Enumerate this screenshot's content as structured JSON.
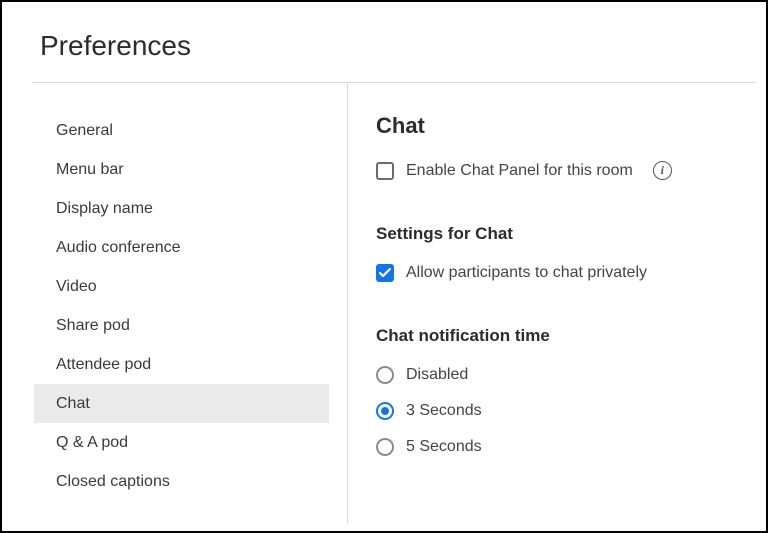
{
  "title": "Preferences",
  "sidebar": {
    "items": [
      {
        "label": "General",
        "selected": false
      },
      {
        "label": "Menu bar",
        "selected": false
      },
      {
        "label": "Display name",
        "selected": false
      },
      {
        "label": "Audio conference",
        "selected": false
      },
      {
        "label": "Video",
        "selected": false
      },
      {
        "label": "Share pod",
        "selected": false
      },
      {
        "label": "Attendee pod",
        "selected": false
      },
      {
        "label": "Chat",
        "selected": true
      },
      {
        "label": "Q & A pod",
        "selected": false
      },
      {
        "label": "Closed captions",
        "selected": false
      }
    ]
  },
  "panel": {
    "title": "Chat",
    "enable_checkbox": {
      "label": "Enable Chat Panel for this room",
      "checked": false
    },
    "settings_title": "Settings for Chat",
    "allow_private": {
      "label": "Allow participants to chat privately",
      "checked": true
    },
    "notification_title": "Chat notification time",
    "notification_options": [
      {
        "label": "Disabled",
        "selected": false
      },
      {
        "label": "3 Seconds",
        "selected": true
      },
      {
        "label": "5 Seconds",
        "selected": false
      }
    ]
  }
}
